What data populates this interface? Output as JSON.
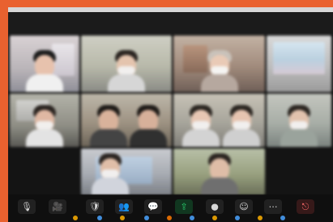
{
  "meeting": {
    "title": ""
  },
  "colors": {
    "frame_orange": "#e9612f",
    "window_bg": "#141414",
    "bar_bg": "#0f0f0f"
  },
  "participants": [
    {
      "id": 1,
      "row": 1,
      "col": 1,
      "name": ""
    },
    {
      "id": 2,
      "row": 1,
      "col": 2,
      "name": ""
    },
    {
      "id": 3,
      "row": 1,
      "col": 3,
      "name": ""
    },
    {
      "id": 4,
      "row": 1,
      "col": 4,
      "name": ""
    },
    {
      "id": 5,
      "row": 2,
      "col": 1,
      "name": ""
    },
    {
      "id": 6,
      "row": 2,
      "col": 2,
      "name": ""
    },
    {
      "id": 7,
      "row": 2,
      "col": 3,
      "name": ""
    },
    {
      "id": 8,
      "row": 2,
      "col": 4,
      "name": ""
    },
    {
      "id": 9,
      "row": 3,
      "col": 2,
      "name": ""
    },
    {
      "id": 10,
      "row": 3,
      "col": 3,
      "name": ""
    }
  ],
  "toolbar": {
    "icons": [
      {
        "name": "mic-icon",
        "glyph": "🎙"
      },
      {
        "name": "video-icon",
        "glyph": "🎥"
      },
      {
        "name": "security-icon",
        "glyph": "🛡"
      },
      {
        "name": "participants-icon",
        "glyph": "👥"
      },
      {
        "name": "chat-icon",
        "glyph": "💬"
      },
      {
        "name": "share-screen-icon",
        "glyph": "⇪"
      },
      {
        "name": "record-icon",
        "glyph": "●"
      },
      {
        "name": "reactions-icon",
        "glyph": "☺"
      },
      {
        "name": "more-icon",
        "glyph": "⋯"
      },
      {
        "name": "end-meeting-icon",
        "glyph": "⎋"
      }
    ],
    "status_dots": [
      {
        "name": "status-dot-1",
        "color": "#ffb000"
      },
      {
        "name": "status-dot-2",
        "color": "#4aa3ff"
      },
      {
        "name": "status-dot-3",
        "color": "#ffb000"
      },
      {
        "name": "status-dot-4",
        "color": "#4aa3ff"
      },
      {
        "name": "status-dot-5",
        "color": "#ff7a00"
      },
      {
        "name": "status-dot-6",
        "color": "#4aa3ff"
      },
      {
        "name": "status-dot-7",
        "color": "#ffb000"
      },
      {
        "name": "status-dot-8",
        "color": "#4aa3ff"
      },
      {
        "name": "status-dot-9",
        "color": "#ffb000"
      },
      {
        "name": "status-dot-10",
        "color": "#4aa3ff"
      }
    ]
  }
}
